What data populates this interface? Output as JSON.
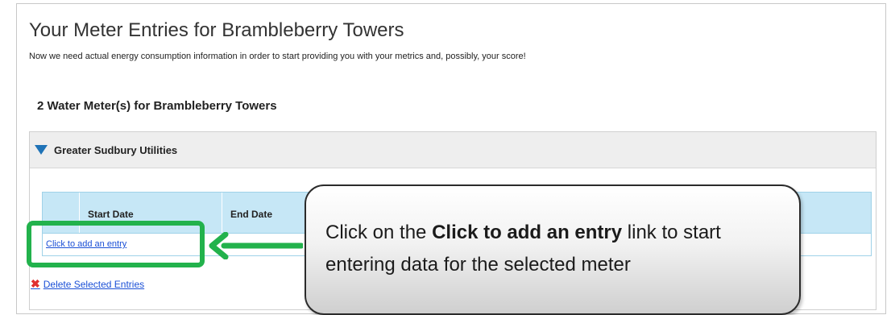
{
  "page": {
    "title": "Your Meter Entries for Brambleberry Towers",
    "subtitle": "Now we need actual energy consumption information in order to start providing you with your metrics and, possibly, your score!"
  },
  "section": {
    "heading": "2 Water Meter(s) for Brambleberry Towers"
  },
  "meter": {
    "name": "Greater Sudbury Utilities",
    "expanded_icon": "triangle-down-icon",
    "table": {
      "columns": [
        "",
        "Start Date",
        "End Date"
      ],
      "add_entry_link": "Click to add an entry"
    },
    "delete_link": "Delete Selected Entries",
    "delete_icon": "x-icon"
  },
  "callout": {
    "text_before": "Click on the ",
    "text_bold": "Click to add an entry",
    "text_after": " link to start entering data for the selected meter"
  },
  "colors": {
    "highlight": "#22b24c",
    "link": "#1a4fd6",
    "table_header": "#c6e7f6",
    "triangle": "#1f73b7",
    "delete_x": "#e03030"
  }
}
